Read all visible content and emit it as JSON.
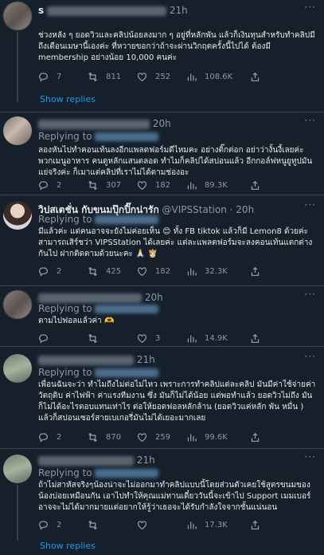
{
  "replies": [
    {
      "name": "s",
      "time": "21h",
      "replying_to": "Replying to",
      "text": "ช่วงหลัง ๆ ยอดวิวและคลิปน้อยลงมาก ๆ อยู่ที่หลักพัน แล้วก็เงินทุนสำหรับทำคลิปมีถึงเดือนเมษานี้เองค่ะ ที่หวายขอกว่าถ้าจะผ่านวิกฤตครั้งนี้ไปได้ ต้องมี membership อย่างน้อย 10,000 คนค่ะ",
      "stats": {
        "replies": "7",
        "retweets": "811",
        "likes": "252",
        "views": "108.6K"
      },
      "show_replies": "Show replies"
    },
    {
      "name": "",
      "time": "20h",
      "replying_to": "Replying to",
      "text": "ลองหันไปทำคอนเท้นลงอีกแพลตฟอร์มดีไหมคะ อย่างติ๊กต่อก อย่าว่างั้นงี้เลยค่ะ พวกเมนูอาหาร คนดูหลักแสนตลอด ทำไมก็คลิปได้สปอนแล้ว อีกกอล์ฟหนูยูทูปมันแย่จริงค่ะ ก็เมาแต่คลิปที่เราไม่ได้ตามช่องอะ",
      "stats": {
        "replies": "2",
        "retweets": "307",
        "likes": "182",
        "views": "89.3K"
      }
    },
    {
      "name": "วิปสเตชั่น กับขนมปุ๊กปิ๊กน่ารัก",
      "handle": "@VIPSStation",
      "time": "20h",
      "replying_to": "Replying to",
      "text_a": "มีแล้วค่ะ แต่คนอาจจะยังไม่ค่อยเห็น ",
      "text_b": " ทั้ง FB tiktok แล้วก็มี Lemon8 ด้วยค่ะ สามารถเสิร์ชว่า VIPSStation ได้เลยค่ะ แต่ละแพลตฟอร์มจะลงคอนเท้นแตกต่างกันไป ฝากติดตามด้วยนะคะ 🙏🏻 👸🏻",
      "stats": {
        "replies": "2",
        "retweets": "425",
        "likes": "182",
        "views": "32.3K"
      }
    },
    {
      "name": "",
      "time": "20h",
      "replying_to": "Replying to",
      "text": "ตามไปฟอลแล้วค่า 🫶",
      "stats": {
        "replies": "",
        "retweets": "",
        "likes": "3",
        "views": "14.9K"
      }
    },
    {
      "name": "",
      "time": "21h",
      "replying_to": "Replying to",
      "text": "เพื่อนฉันจะว่า ทำไมถึงไม่ต่อไม่ไหว เพราะการทำคลิปแต่ละคลิป มันมีค่าใช้จ่ายค่าวัตถุดิบ ค่าไฟฟ้า ค่าแรงทีมงาน ซึ่ง มันก็ไม่ได้น้อย แต่พอทำแล้ว ยอดวิวไม่ถึง มันก็ไม่ได้อะไรตอบแทนเท่าไร ต่อให้ยอดฟอลหลักล้าน (ยอดวิวแค่หลัก พัน หมื่น ) แล้วก็สปอนเซอร์สายเบเกอรี่มันไม่ได้เยอะมากเลย",
      "stats": {
        "replies": "2",
        "retweets": "870",
        "likes": "259",
        "views": "99.6K"
      }
    },
    {
      "name": "",
      "time": "21h",
      "replying_to": "Replying to",
      "text": "ถ้าไม่สาหัสจริงๆน้องน่าจะไม่ออกมาทำคลิปแบบนี้โดยส่วนตัวเคยใช้สูตรขนมของน้องบ่อยเหมือนกัน เอาไปทำให้คุณแม่ทานเดี๋ยววันนี้จะเข้าไป Support เมมเบอร์ อาจจะไม่ได้มากมายแต่อยากให้รู้ว่าเธอจะได้รับกำลังใจจากชั้นแน่นอน",
      "stats": {
        "replies": "2",
        "retweets": "",
        "likes": "",
        "views": "17.3K"
      },
      "show_replies": "Show replies"
    }
  ]
}
